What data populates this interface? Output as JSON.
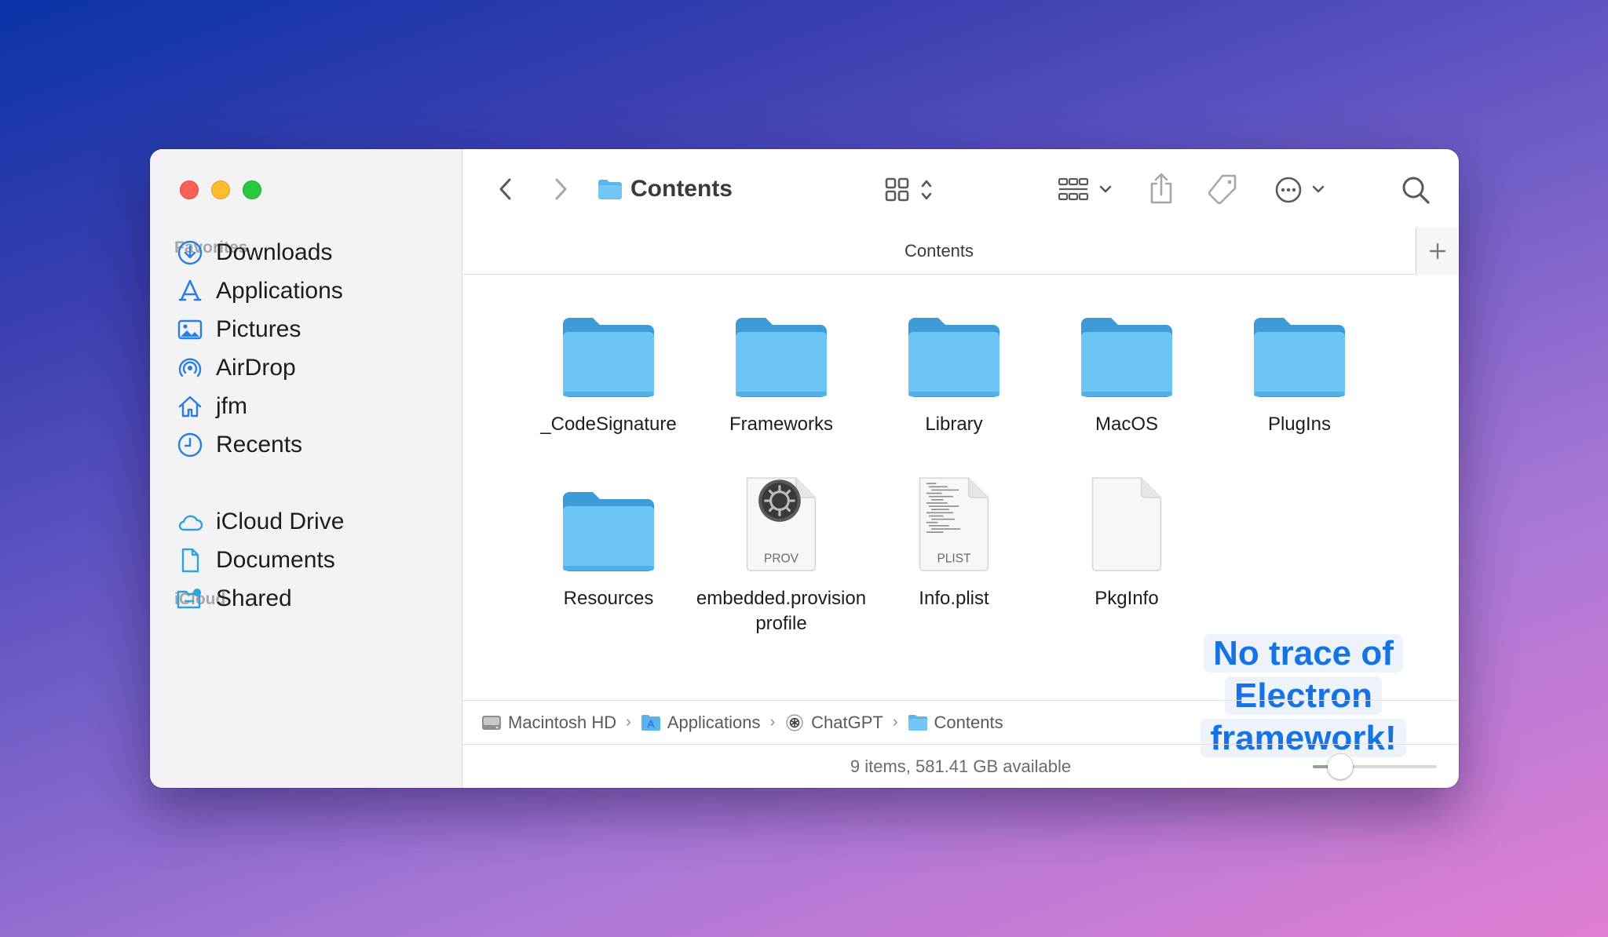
{
  "window": {
    "title": "Contents",
    "tab_label": "Contents"
  },
  "sidebar": {
    "favorites_title": "Favorites",
    "favorites": [
      {
        "label": "Downloads",
        "icon": "downloads-icon"
      },
      {
        "label": "Applications",
        "icon": "applications-icon"
      },
      {
        "label": "Pictures",
        "icon": "pictures-icon"
      },
      {
        "label": "AirDrop",
        "icon": "airdrop-icon"
      },
      {
        "label": "jfm",
        "icon": "home-icon"
      },
      {
        "label": "Recents",
        "icon": "recents-icon"
      }
    ],
    "icloud_title": "iCloud",
    "icloud": [
      {
        "label": "iCloud Drive",
        "icon": "icloud-icon"
      },
      {
        "label": "Documents",
        "icon": "document-icon"
      },
      {
        "label": "Shared",
        "icon": "shared-folder-icon"
      }
    ]
  },
  "items": [
    {
      "label": "_CodeSignature",
      "kind": "folder"
    },
    {
      "label": "Frameworks",
      "kind": "folder"
    },
    {
      "label": "Library",
      "kind": "folder"
    },
    {
      "label": "MacOS",
      "kind": "folder"
    },
    {
      "label": "PlugIns",
      "kind": "folder"
    },
    {
      "label": "Resources",
      "kind": "folder"
    },
    {
      "label": "embedded.provisionprofile",
      "kind": "file",
      "badge": "PROV"
    },
    {
      "label": "Info.plist",
      "kind": "file",
      "badge": "PLIST"
    },
    {
      "label": "PkgInfo",
      "kind": "file",
      "badge": ""
    }
  ],
  "annotation": {
    "lines": [
      "No trace of",
      "Electron",
      "framework!"
    ]
  },
  "pathbar": {
    "crumbs": [
      {
        "label": "Macintosh HD",
        "icon": "disk-icon"
      },
      {
        "label": "Applications",
        "icon": "applications-folder-icon"
      },
      {
        "label": "ChatGPT",
        "icon": "chatgpt-icon"
      },
      {
        "label": "Contents",
        "icon": "folder-icon"
      }
    ]
  },
  "status": {
    "text": "9 items, 581.41 GB available",
    "icon_size_fraction": 0.22
  },
  "colors": {
    "folder": "#6cc5f4",
    "accent": "#1673e6"
  }
}
